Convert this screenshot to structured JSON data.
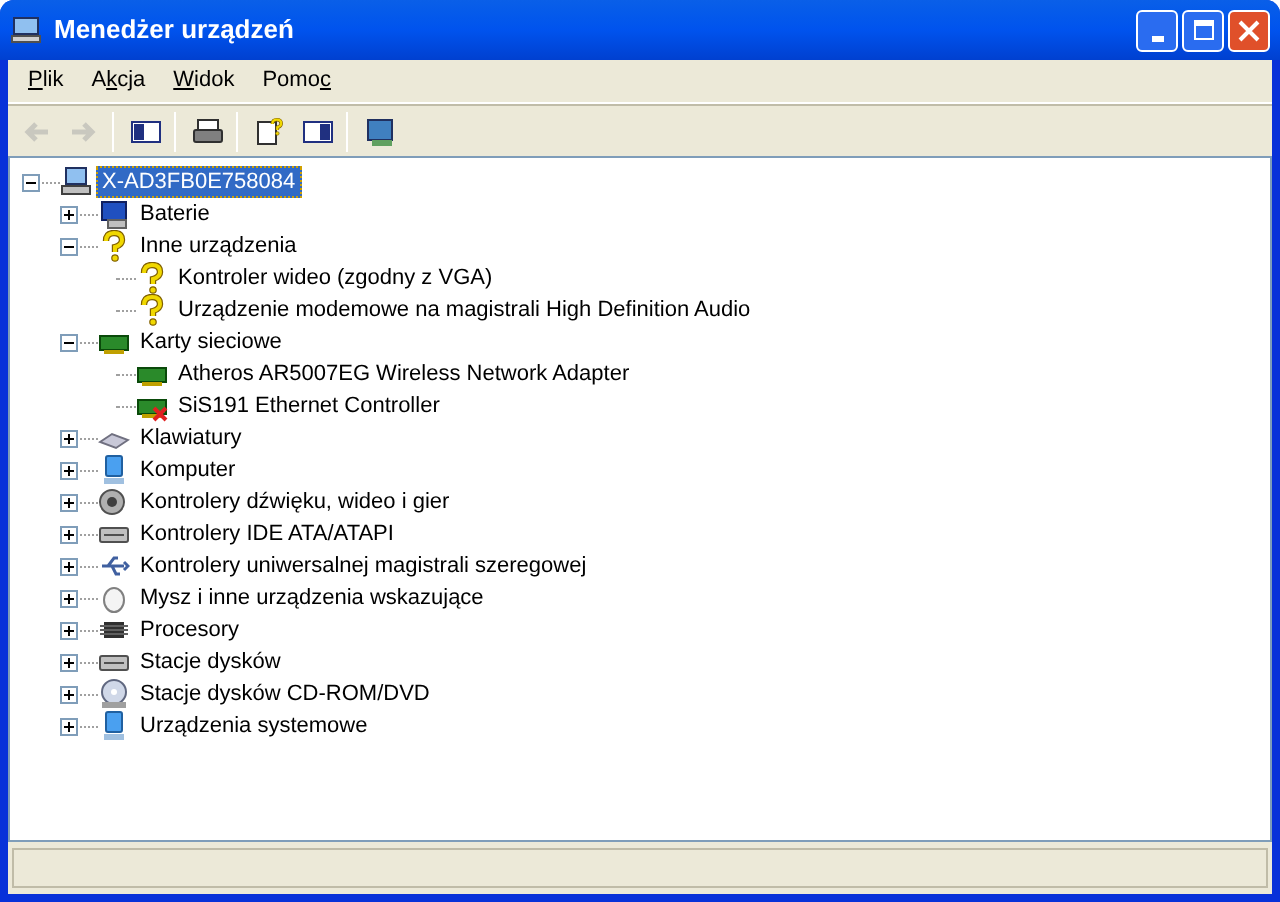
{
  "window": {
    "title": "Menedżer urządzeń"
  },
  "menu": [
    {
      "key": "P",
      "after": "lik"
    },
    {
      "before": "A",
      "key": "k",
      "after": "cja"
    },
    {
      "key": "W",
      "after": "idok"
    },
    {
      "before": "Pomo",
      "key": "c"
    }
  ],
  "toolbar": [
    {
      "disabled": true
    },
    {
      "disabled": true
    },
    {
      "disabled": false
    },
    {
      "disabled": false
    },
    {
      "disabled": false
    },
    {
      "disabled": false
    },
    {
      "disabled": false
    }
  ],
  "tree": {
    "label": "X-AD3FB0E758084",
    "selected": true,
    "expanded": true,
    "children": [
      {
        "label": "Baterie",
        "expanded": false,
        "selected": false
      },
      {
        "label": "Inne urządzenia",
        "expanded": true,
        "selected": false,
        "children": [
          {
            "label": "Kontroler wideo (zgodny z VGA)",
            "warning": true,
            "disabled": false,
            "selected": false
          },
          {
            "label": "Urządzenie modemowe na magistrali High Definition Audio",
            "warning": true,
            "disabled": false,
            "selected": false
          }
        ]
      },
      {
        "label": "Karty sieciowe",
        "expanded": true,
        "selected": false,
        "children": [
          {
            "label": "Atheros AR5007EG Wireless Network Adapter",
            "warning": false,
            "disabled": false,
            "selected": false
          },
          {
            "label": "SiS191 Ethernet Controller",
            "warning": false,
            "disabled": true,
            "selected": false
          }
        ]
      },
      {
        "label": "Klawiatury",
        "expanded": false,
        "selected": false
      },
      {
        "label": "Komputer",
        "expanded": false,
        "selected": false
      },
      {
        "label": "Kontrolery dźwięku, wideo i gier",
        "expanded": false,
        "selected": false
      },
      {
        "label": "Kontrolery IDE ATA/ATAPI",
        "expanded": false,
        "selected": false
      },
      {
        "label": "Kontrolery uniwersalnej magistrali szeregowej",
        "expanded": false,
        "selected": false
      },
      {
        "label": "Mysz i inne urządzenia wskazujące",
        "expanded": false,
        "selected": false
      },
      {
        "label": "Procesory",
        "expanded": false,
        "selected": false
      },
      {
        "label": "Stacje dysków",
        "expanded": false,
        "selected": false
      },
      {
        "label": "Stacje dysków CD-ROM/DVD",
        "expanded": false,
        "selected": false
      },
      {
        "label": "Urządzenia systemowe",
        "expanded": false,
        "selected": false
      }
    ]
  }
}
